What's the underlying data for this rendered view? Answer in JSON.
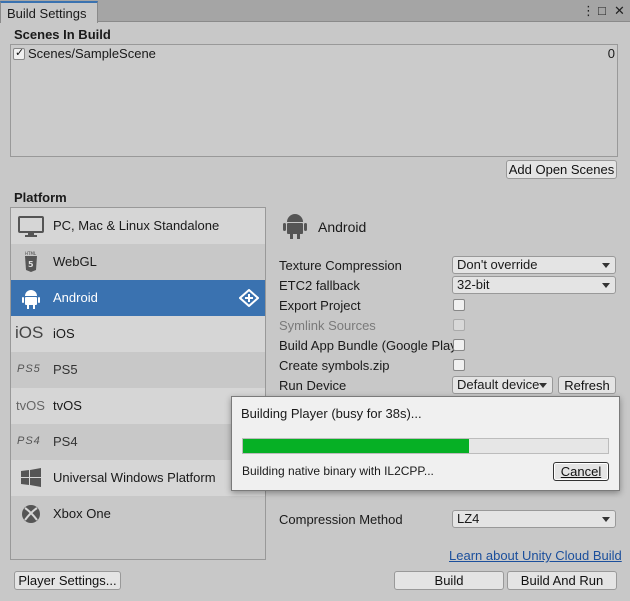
{
  "window": {
    "tab_title": "Build Settings",
    "menu_glyph": "⋮",
    "maximize_glyph": "□",
    "close_glyph": "✕"
  },
  "scenes": {
    "heading": "Scenes In Build",
    "items": [
      {
        "name": "Scenes/SampleScene",
        "index": "0",
        "checked": true
      }
    ],
    "add_open_scenes": "Add Open Scenes"
  },
  "platform": {
    "heading": "Platform",
    "items": [
      {
        "label": "PC, Mac & Linux Standalone",
        "icon": "monitor-icon",
        "selected": false
      },
      {
        "label": "WebGL",
        "icon": "html5-icon",
        "selected": false
      },
      {
        "label": "Android",
        "icon": "android-icon",
        "selected": true
      },
      {
        "label": "iOS",
        "icon": "ios-icon",
        "icon_text": "iOS",
        "selected": false
      },
      {
        "label": "PS5",
        "icon": "ps5-icon",
        "icon_text": "PS5",
        "selected": false
      },
      {
        "label": "tvOS",
        "icon": "tvos-icon",
        "icon_text": "tvOS",
        "selected": false
      },
      {
        "label": "PS4",
        "icon": "ps4-icon",
        "icon_text": "PS4",
        "selected": false
      },
      {
        "label": "Universal Windows Platform",
        "icon": "windows-icon",
        "selected": false
      },
      {
        "label": "Xbox One",
        "icon": "xbox-icon",
        "selected": false
      }
    ],
    "active_icon": "unity-logo-icon"
  },
  "settings": {
    "platform_title": "Android",
    "texture_compression": {
      "label": "Texture Compression",
      "value": "Don't override"
    },
    "etc2_fallback": {
      "label": "ETC2 fallback",
      "value": "32-bit"
    },
    "export_project": {
      "label": "Export Project"
    },
    "symlink_sources": {
      "label": "Symlink Sources"
    },
    "build_app_bundle": {
      "label": "Build App Bundle (Google Play"
    },
    "create_symbols": {
      "label": "Create symbols.zip"
    },
    "run_device": {
      "label": "Run Device",
      "value": "Default device",
      "refresh": "Refresh"
    },
    "compression_method": {
      "label": "Compression Method",
      "value": "LZ4"
    }
  },
  "footer": {
    "cloud_link": "Learn about Unity Cloud Build",
    "player_settings": "Player Settings...",
    "build": "Build",
    "build_and_run": "Build And Run"
  },
  "dialog": {
    "title": "Building Player (busy for 38s)...",
    "progress": 0.62,
    "status": "Building native binary with IL2CPP...",
    "cancel": "Cancel",
    "progress_color": "#06b025"
  },
  "colors": {
    "selection": "#3a72b0",
    "link": "#1b4f9c"
  }
}
